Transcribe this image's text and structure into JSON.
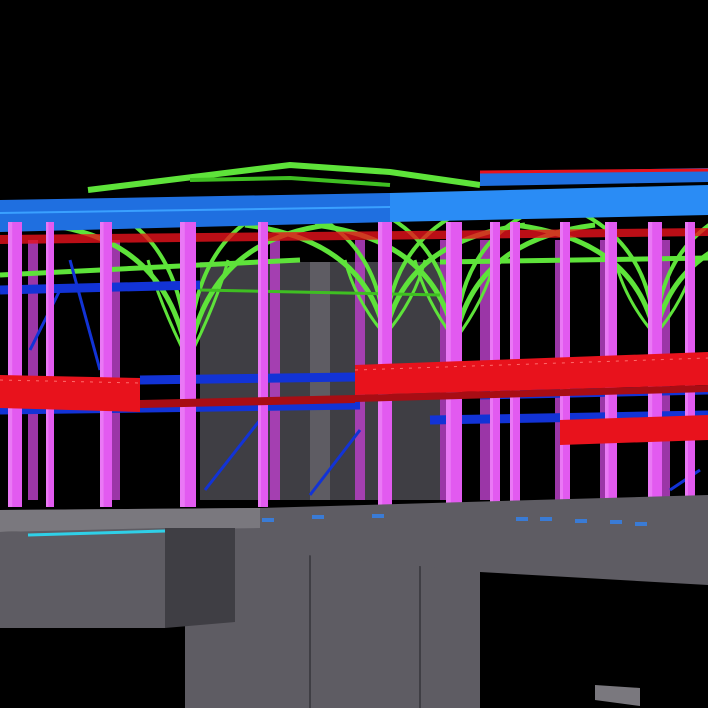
{
  "viewport": {
    "background": "#000000"
  },
  "palette": {
    "roof_beam": "#1f6fe0",
    "roof_beam_light": "#2a8cf5",
    "green_truss": "#5ee33a",
    "green_dark": "#3fbf22",
    "column": "#e25af0",
    "column_dark": "#b63fc4",
    "floor_beam": "#e8121c",
    "floor_beam_dark": "#a80d14",
    "secondary_beam": "#1233d6",
    "concrete": "#5e5c63",
    "concrete_light": "#7a787e",
    "concrete_dark": "#3f3e44",
    "cyan_edge": "#2fd0e8",
    "hardware": "#3a7bd5"
  },
  "scene": {
    "kind": "3d-structural-model-view",
    "elements": [
      "roof-beams",
      "green-tree-trusses",
      "magenta-columns",
      "red-floor-beams",
      "blue-secondary-beams",
      "concrete-slab",
      "concrete-core",
      "column-base-plates"
    ]
  }
}
